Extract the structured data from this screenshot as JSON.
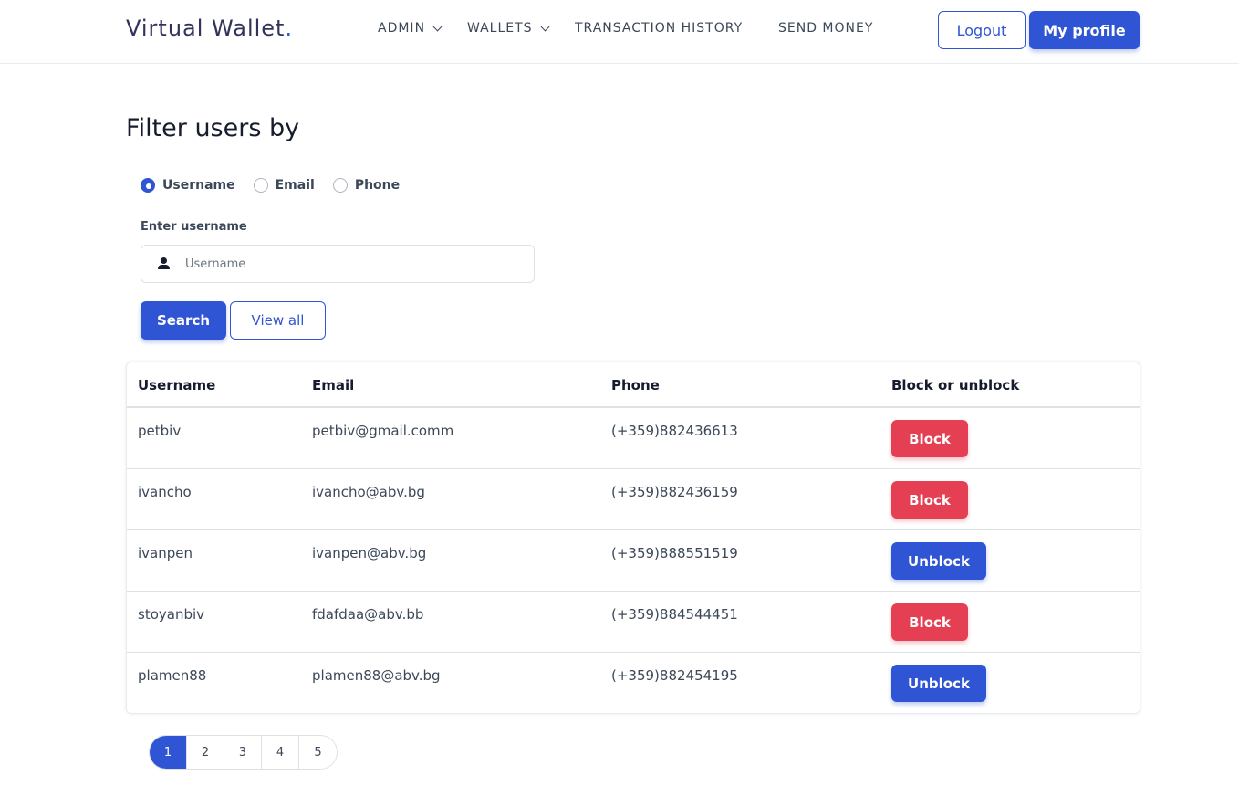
{
  "navbar": {
    "brand": "Virtual Wallet",
    "brand_dot": ".",
    "links": [
      {
        "label": "ADMIN",
        "dropdown": true
      },
      {
        "label": "WALLETS",
        "dropdown": true
      },
      {
        "label": "TRANSACTION HISTORY",
        "dropdown": false
      },
      {
        "label": "SEND MONEY",
        "dropdown": false
      }
    ],
    "logout_label": "Logout",
    "profile_label": "My profile"
  },
  "filter": {
    "title": "Filter users by",
    "options": [
      {
        "label": "Username",
        "checked": true
      },
      {
        "label": "Email",
        "checked": false
      },
      {
        "label": "Phone",
        "checked": false
      }
    ],
    "field_label": "Enter username",
    "input_value": "",
    "input_placeholder": "Username",
    "search_label": "Search",
    "view_all_label": "View all"
  },
  "table": {
    "headers": [
      "Username",
      "Email",
      "Phone",
      "Block or unblock"
    ],
    "rows": [
      {
        "username": "petbiv",
        "email": "petbiv@gmail.comm",
        "phone": "(+359)882436613",
        "action": "Block"
      },
      {
        "username": "ivancho",
        "email": "ivancho@abv.bg",
        "phone": "(+359)882436159",
        "action": "Block"
      },
      {
        "username": "ivanpen",
        "email": "ivanpen@abv.bg",
        "phone": "(+359)888551519",
        "action": "Unblock"
      },
      {
        "username": "stoyanbiv",
        "email": "fdafdaa@abv.bb",
        "phone": "(+359)884544451",
        "action": "Block"
      },
      {
        "username": "plamen88",
        "email": "plamen88@abv.bg",
        "phone": "(+359)882454195",
        "action": "Unblock"
      }
    ]
  },
  "pagination": {
    "pages": [
      "1",
      "2",
      "3",
      "4",
      "5"
    ],
    "active": "1"
  },
  "colors": {
    "primary": "#2f55d4",
    "danger": "#e43f52"
  }
}
